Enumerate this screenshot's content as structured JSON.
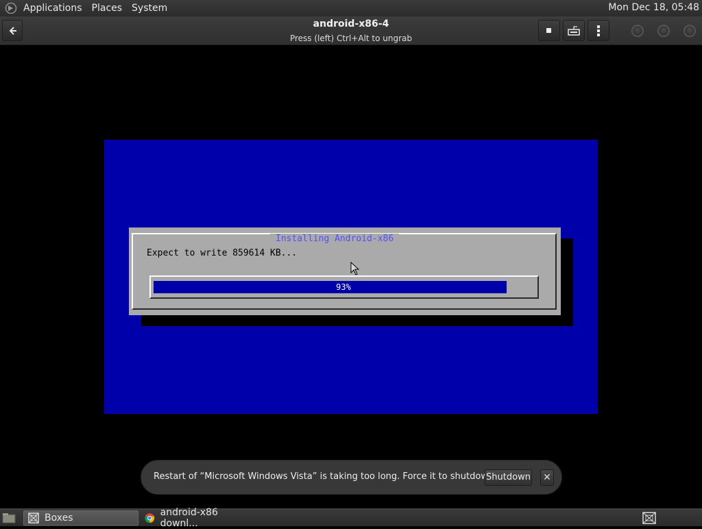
{
  "top_panel": {
    "menus": [
      "Applications",
      "Places",
      "System"
    ],
    "clock": "Mon Dec 18, 05:48"
  },
  "header": {
    "title": "android-x86-4",
    "subtitle": "Press (left) Ctrl+Alt to ungrab",
    "icons": {
      "back": "back-arrow-icon",
      "stop": "stop-icon",
      "keyboard": "keyboard-icon",
      "menu": "kebab-menu-icon"
    }
  },
  "vm": {
    "dialog_title": "Installing Android-x86",
    "message": "Expect to write 859614 KB...",
    "progress_label": "93%",
    "progress_value": 0.93,
    "colors": {
      "screen": "#0000aa",
      "dialog": "#aaaaaa",
      "title": "#5050ff"
    }
  },
  "notification": {
    "message": "Restart of “Microsoft Windows Vista” is taking too long. Force it to shutdown?",
    "button": "Shutdown",
    "close": "✕"
  },
  "taskbar": {
    "tasks": [
      {
        "label": "Boxes",
        "icon": "boxes-icon",
        "active": true
      },
      {
        "label": "android-x86 downl...",
        "icon": "chrome-icon",
        "active": false
      }
    ]
  }
}
